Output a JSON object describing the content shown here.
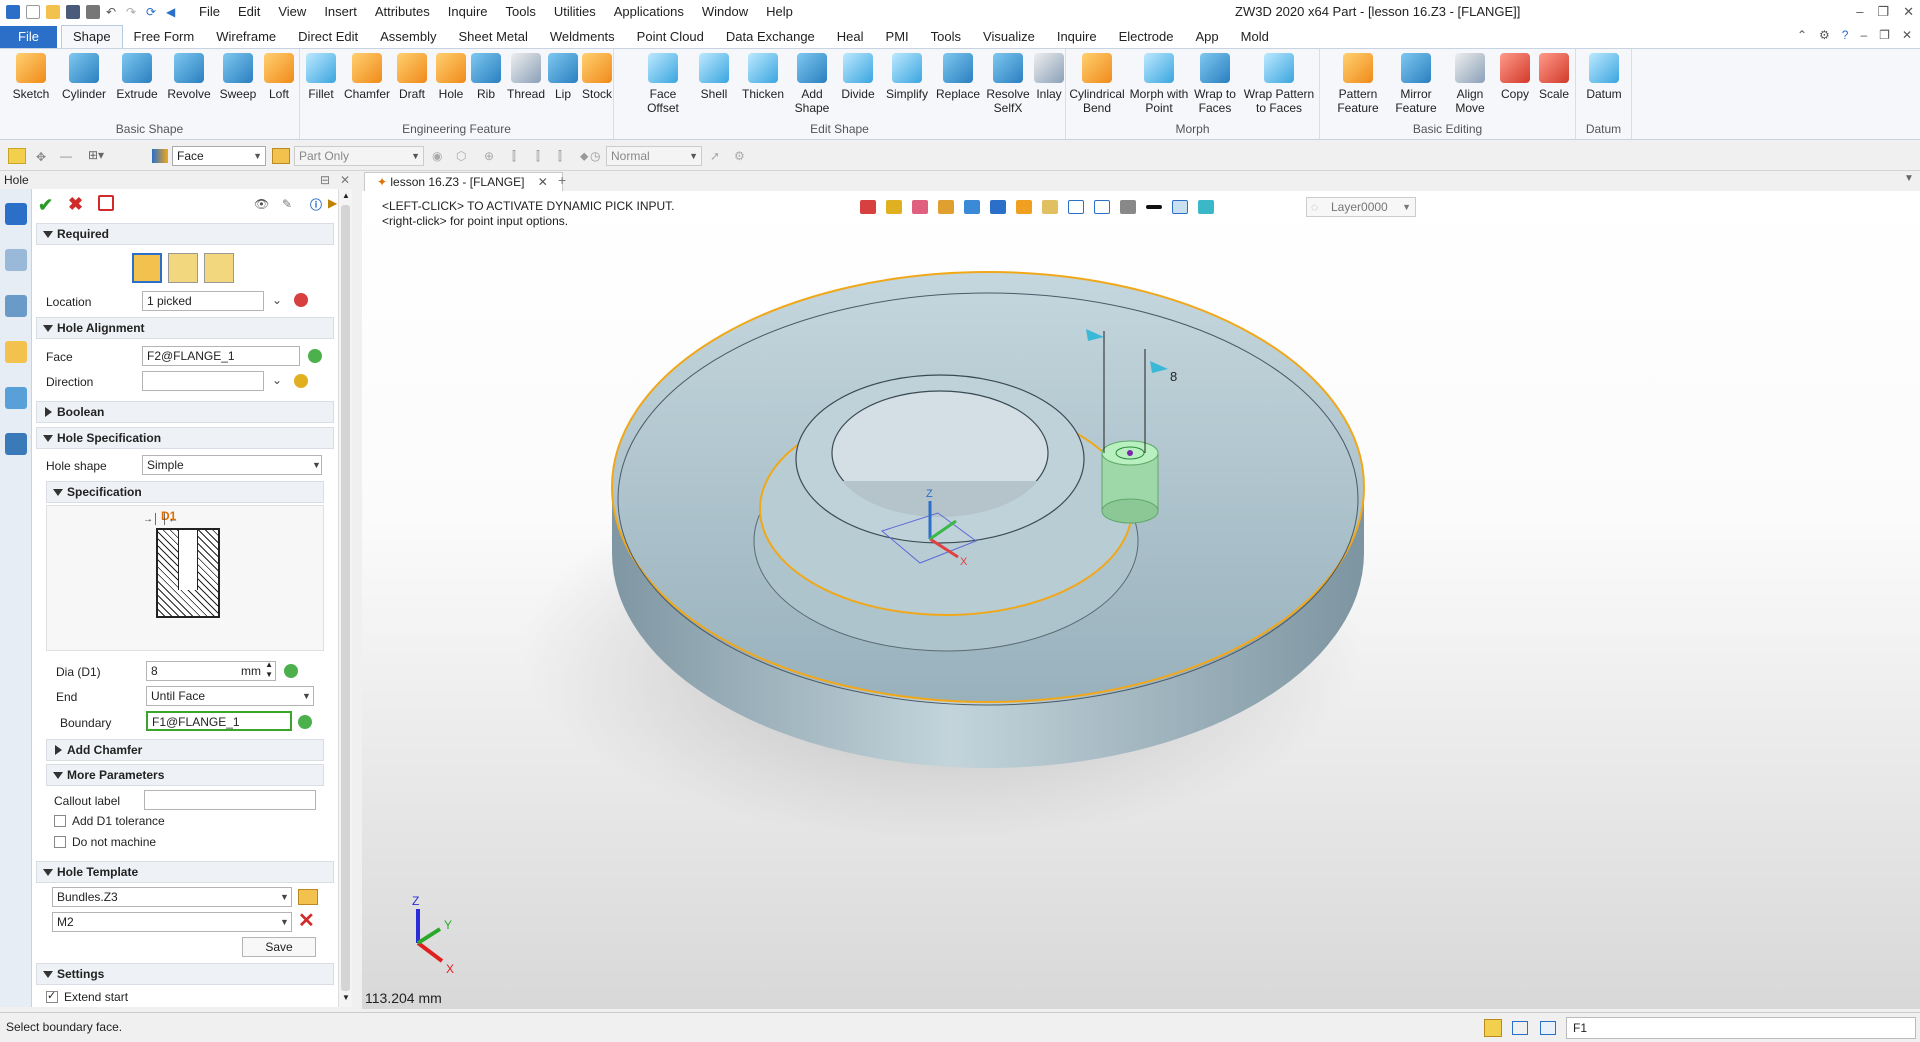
{
  "titlebar": {
    "menu": [
      "File",
      "Edit",
      "View",
      "Insert",
      "Attributes",
      "Inquire",
      "Tools",
      "Utilities",
      "Applications",
      "Window",
      "Help"
    ],
    "title": "ZW3D 2020 x64     Part - [lesson 16.Z3 - [FLANGE]]"
  },
  "ribbon_tabs": [
    "Shape",
    "Free Form",
    "Wireframe",
    "Direct Edit",
    "Assembly",
    "Sheet Metal",
    "Weldments",
    "Point Cloud",
    "Data Exchange",
    "Heal",
    "PMI",
    "Tools",
    "Visualize",
    "Inquire",
    "Electrode",
    "App",
    "Mold"
  ],
  "file_tab": "File",
  "ribbon": {
    "basic_shape": {
      "title": "Basic Shape",
      "buttons": [
        "Sketch",
        "Cylinder",
        "Extrude",
        "Revolve",
        "Sweep",
        "Loft"
      ]
    },
    "engineering_feature": {
      "title": "Engineering Feature",
      "buttons": [
        "Fillet",
        "Chamfer",
        "Draft",
        "Hole",
        "Rib",
        "Thread",
        "Lip",
        "Stock"
      ]
    },
    "edit_shape": {
      "title": "Edit Shape",
      "buttons": [
        "Face Offset",
        "Shell",
        "Thicken",
        "Add Shape",
        "Divide",
        "Simplify",
        "Replace",
        "Resolve SelfX",
        "Inlay"
      ]
    },
    "morph": {
      "title": "Morph",
      "buttons": [
        "Cylindrical Bend",
        "Morph with Point",
        "Wrap to Faces",
        "Wrap Pattern to Faces"
      ]
    },
    "basic_editing": {
      "title": "Basic Editing",
      "buttons": [
        "Pattern Feature",
        "Mirror Feature",
        "Align Move",
        "Copy",
        "Scale"
      ]
    },
    "datum": {
      "title": "Datum",
      "buttons": [
        "Datum"
      ]
    }
  },
  "toolbar": {
    "filter": "Face",
    "scope": "Part Only",
    "display": "Normal"
  },
  "panel": {
    "title": "Hole",
    "required": "Required",
    "location_label": "Location",
    "location_value": "1 picked",
    "hole_alignment": "Hole Alignment",
    "face_label": "Face",
    "face_value": "F2@FLANGE_1",
    "direction_label": "Direction",
    "direction_value": "",
    "boolean": "Boolean",
    "hole_specification": "Hole Specification",
    "hole_shape_label": "Hole shape",
    "hole_shape_value": "Simple",
    "specification": "Specification",
    "diagram_label": "D1",
    "dia_label": "Dia (D1)",
    "dia_value": "8",
    "dia_unit": "mm",
    "end_label": "End",
    "end_value": "Until Face",
    "boundary_label": "Boundary",
    "boundary_value": "F1@FLANGE_1",
    "add_chamfer": "Add Chamfer",
    "more_parameters": "More Parameters",
    "callout_label": "Callout label",
    "add_d1_tolerance": "Add D1 tolerance",
    "do_not_machine": "Do not machine",
    "hole_template": "Hole Template",
    "template_file": "Bundles.Z3",
    "template_size": "M2",
    "save": "Save",
    "settings": "Settings",
    "extend_start": "Extend start"
  },
  "viewport": {
    "doc_tab": "lesson 16.Z3 - [FLANGE]",
    "prompt_line1": "<LEFT-CLICK> TO ACTIVATE DYNAMIC PICK INPUT.",
    "prompt_line2": "<right-click> for point input options.",
    "layer": "Layer0000",
    "dim_value": "8",
    "measure": "113.204 mm",
    "axis_x": "X",
    "axis_y": "Y",
    "axis_z": "Z"
  },
  "status": {
    "message": "Select boundary face.",
    "command_input": "F1"
  },
  "colors": {
    "accent": "#2b6fc8",
    "highlight": "#f0a81a",
    "pick_green": "#3aa52a",
    "part_body": "#a9c1cc"
  }
}
